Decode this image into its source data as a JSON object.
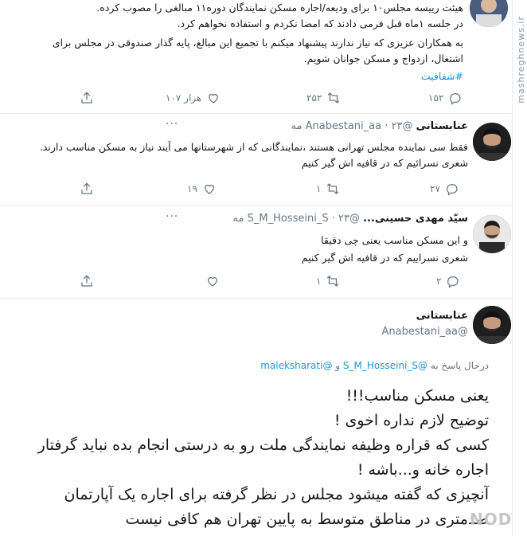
{
  "tweet1": {
    "lines": [
      "هیئت رییسه مجلس۱۰ برای ودیعه/اجاره مسکن نمایندگان دوره۱۱ مبالغی را مصوب کرده.",
      "در جلسه ۱ماه قبل فرمی دادند که امضا نکردم و استفاده نخواهم کرد.",
      "به همکاران عزیزی که نیاز ندارند پیشنهاد میکنم با تجمیع این مبالغ، پایه گذار صندوقی در مجلس برای",
      "اشتغال، ازدواج و مسکن جوانان شویم."
    ],
    "hashtag": "#شفافیت",
    "reply_count": "۱۵۲",
    "retweet_count": "۲۵۲",
    "like_count": "۱۰۷ هزار"
  },
  "tweet2": {
    "name": "عنابستانی",
    "handle": "@Anabestani_aa",
    "time": "۲۳ مه",
    "lines": [
      "فقط سی نماینده مجلس تهرانی هستند ،نمایندگانی که از شهرستانها می آیند نیاز به مسکن مناسب دارند.",
      "شعری نسرائیم که در قافیه اش گیر کنیم"
    ],
    "reply_count": "۲۷",
    "retweet_count": "۱",
    "like_count": "۱۹"
  },
  "tweet3": {
    "name": "سیّد مهدی حسینی...",
    "handle": "@S_M_Hosseini_S",
    "time": "۲۳ مه",
    "lines": [
      "و این مسکن مناسب یعنی چی دقیقا",
      "شعری نسراییم که در قافیه اش گیر کنیم"
    ],
    "reply_count": "۲",
    "retweet_count": "۱",
    "like_count": ""
  },
  "tweet4": {
    "name": "عنابستانی",
    "handle": "@Anabestani_aa",
    "reply_prefix": "درحال پاسخ به",
    "reply_to_1": "@S_M_Hosseini_S",
    "reply_and": "و",
    "reply_to_2": "@maleksharati",
    "lines": [
      "یعنی مسکن مناسب!!!",
      "توضیح لازم نداره اخوی !",
      "کسی که قراره وظیفه نمایندگی ملت رو به درستی انجام بده نباید گرفتار",
      "اجاره خانه و...باشه !",
      "آنچیزی که گفته میشود مجلس در نظر گرفته برای اجاره یک آپارتمان",
      "صدمتری در مناطق متوسط به پایین تهران هم کافی نیست"
    ]
  },
  "watermark": "mashreghnews.ir",
  "site_logo": "NODY.IR"
}
